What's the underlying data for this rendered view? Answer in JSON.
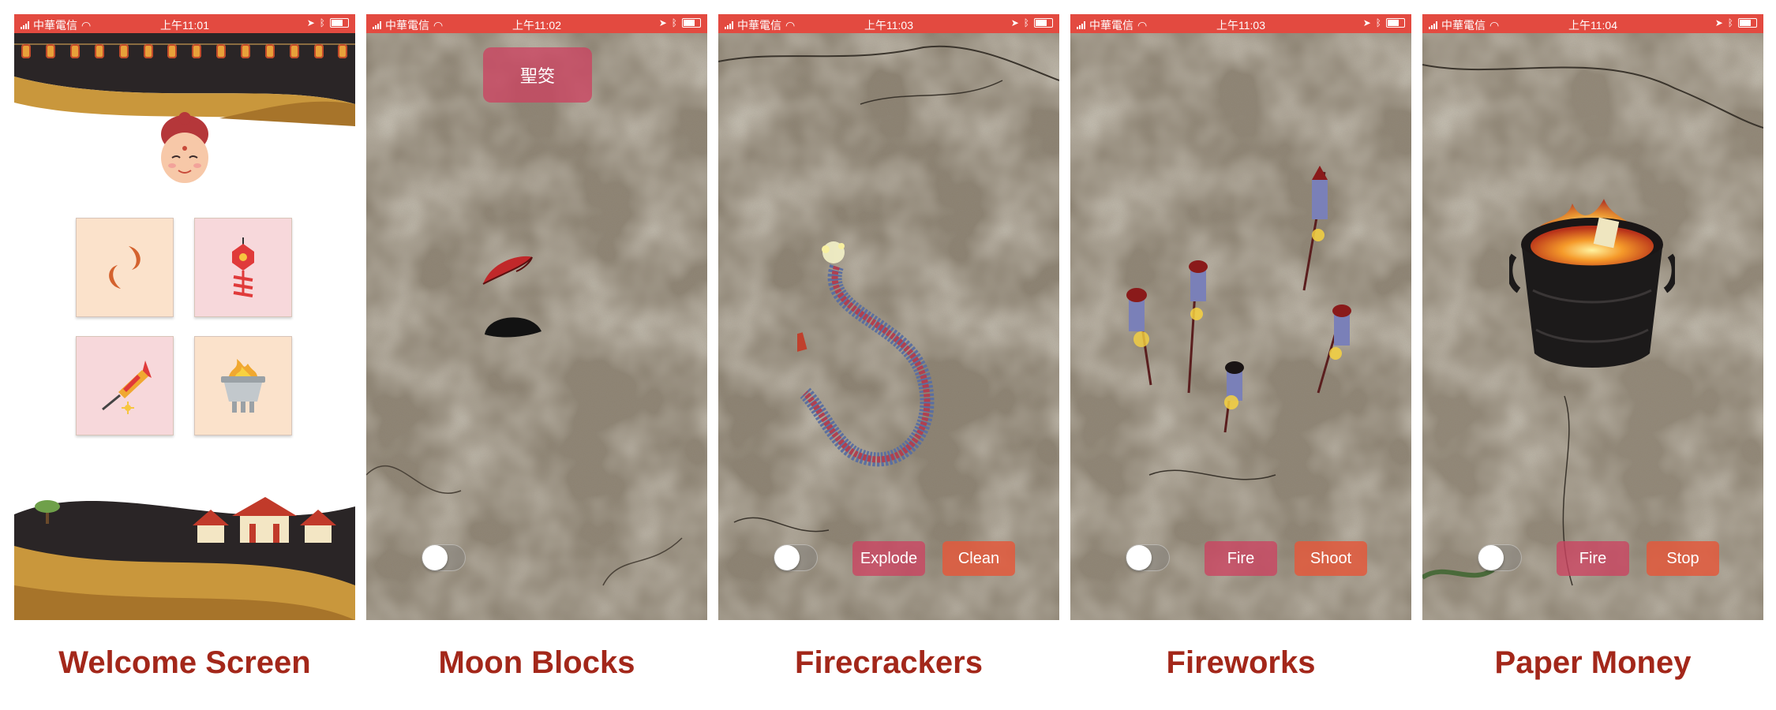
{
  "status_bar": {
    "carrier": "中華電信"
  },
  "screens": [
    {
      "label": "Welcome Screen",
      "time": "上午11:01"
    },
    {
      "label": "Moon Blocks",
      "time": "上午11:02",
      "result_button": "聖筊"
    },
    {
      "label": "Firecrackers",
      "time": "上午11:03",
      "buttons": [
        "Explode",
        "Clean"
      ]
    },
    {
      "label": "Fireworks",
      "time": "上午11:03",
      "buttons": [
        "Fire",
        "Shoot"
      ]
    },
    {
      "label": "Paper Money",
      "time": "上午11:04",
      "buttons": [
        "Fire",
        "Stop"
      ]
    }
  ],
  "welcome_tiles": [
    {
      "icon": "moon-blocks-icon"
    },
    {
      "icon": "firecracker-icon"
    },
    {
      "icon": "firework-rocket-icon"
    },
    {
      "icon": "incense-burner-icon"
    }
  ],
  "colors": {
    "status_bar": "#e34a40",
    "label": "#a3271a",
    "button_pink": "#cc4260",
    "button_orange": "#e25a3c"
  }
}
